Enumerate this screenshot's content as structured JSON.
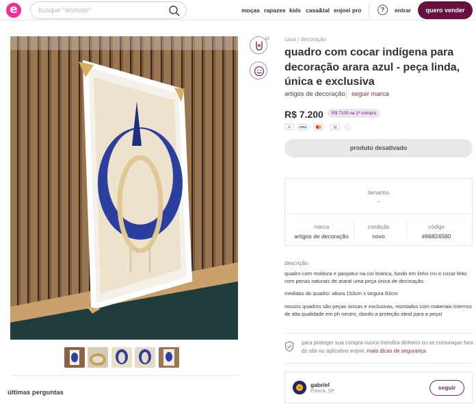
{
  "brand": {
    "logo_letter": "e",
    "color": "#f22c9c"
  },
  "search": {
    "placeholder": "busque \"animale\""
  },
  "nav": [
    {
      "label": "moças"
    },
    {
      "label": "rapazes"
    },
    {
      "label": "kids"
    },
    {
      "label": "casa&tal"
    },
    {
      "label": "enjoei pro"
    }
  ],
  "header": {
    "help_symbol": "?",
    "login_label": "entrar",
    "sell_label": "quero vender",
    "sell_color": "#68103f"
  },
  "product": {
    "breadcrumb": "casa / decoração",
    "title": "quadro com cocar indígena para decoração arara azul - peça linda, única e exclusiva",
    "category": "artigos de decoração",
    "follow_brand_label": "seguir marca",
    "price": "R$ 7.200",
    "pix_promo": "R$ 7100 na 1ª compra",
    "payment_methods": [
      "pix",
      "visa",
      "mastercard",
      "boleto",
      "info"
    ],
    "disabled_label": "produto desativado",
    "like_count": "19"
  },
  "details": {
    "size_label": "tamanho",
    "size_value": "-",
    "brand_label": "marca",
    "brand_value": "artigos de decoração",
    "condition_label": "condição",
    "condition_value": "novo",
    "code_label": "código",
    "code_value": "#66824580"
  },
  "description": {
    "label": "descrição",
    "p1": "quadro com moldura e paspatur na cor branca, fundo em linho cru e cocar feito com penas naturais de arara! uma peça única de decoração.",
    "p2": "medidas do quadro: altura 153cm x largura 83cm",
    "p3": "nossos quadros são peças únicas e exclusivas, montados com materiais internos de alta qualidade em ph neutro, dando a proteção ideal para a peça!"
  },
  "safety": {
    "text": "para proteger sua compra nunca transfira dinheiro ou se comunique fora do site ou aplicativo enjoei.",
    "link": "mais dicas de segurança"
  },
  "seller": {
    "name": "gabriel",
    "location": "Franca, SP",
    "follow_label": "seguir"
  },
  "questions": {
    "title": "últimas perguntas"
  },
  "colors": {
    "accent": "#7b2a66",
    "feather_blue": "#2b3f9e",
    "promo_bg": "#efe1f3"
  }
}
